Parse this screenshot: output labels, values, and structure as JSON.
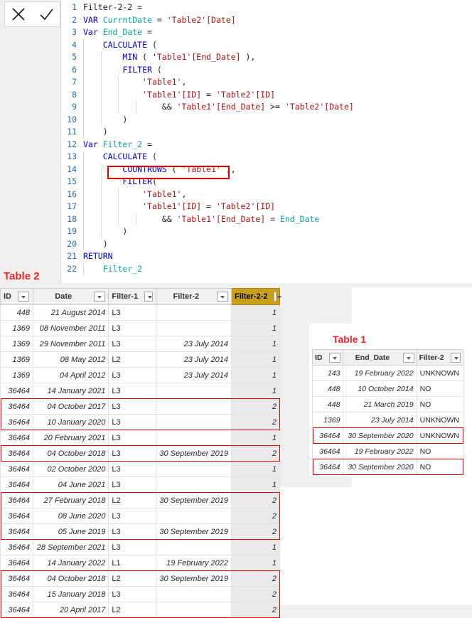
{
  "editor": {
    "commit_icons": [
      {
        "name": "cancel-icon",
        "glyph": "✕"
      },
      {
        "name": "confirm-icon",
        "glyph": "✓"
      }
    ],
    "lines": [
      {
        "n": "1",
        "indent": 0,
        "tokens": [
          {
            "t": "Filter-2-2 =",
            "c": "pl"
          }
        ]
      },
      {
        "n": "2",
        "indent": 0,
        "tokens": [
          {
            "t": "VAR ",
            "c": "kw"
          },
          {
            "t": "CurrntDate",
            "c": "var"
          },
          {
            "t": " = ",
            "c": "op"
          },
          {
            "t": "'Table2'[Date]",
            "c": "str"
          }
        ]
      },
      {
        "n": "3",
        "indent": 0,
        "tokens": [
          {
            "t": "Var ",
            "c": "kw"
          },
          {
            "t": "End_Date",
            "c": "var"
          },
          {
            "t": " =",
            "c": "op"
          }
        ]
      },
      {
        "n": "4",
        "indent": 1,
        "tokens": [
          {
            "t": "CALCULATE",
            "c": "fn"
          },
          {
            "t": " (",
            "c": "op"
          }
        ]
      },
      {
        "n": "5",
        "indent": 2,
        "tokens": [
          {
            "t": "MIN",
            "c": "fn"
          },
          {
            "t": " ( ",
            "c": "op"
          },
          {
            "t": "'Table1'[End_Date]",
            "c": "str"
          },
          {
            "t": " ),",
            "c": "op"
          }
        ]
      },
      {
        "n": "6",
        "indent": 2,
        "tokens": [
          {
            "t": "FILTER",
            "c": "fn"
          },
          {
            "t": " (",
            "c": "op"
          }
        ]
      },
      {
        "n": "7",
        "indent": 3,
        "tokens": [
          {
            "t": "'Table1'",
            "c": "str"
          },
          {
            "t": ",",
            "c": "op"
          }
        ]
      },
      {
        "n": "8",
        "indent": 3,
        "tokens": [
          {
            "t": "'Table1'[ID]",
            "c": "str"
          },
          {
            "t": " = ",
            "c": "op"
          },
          {
            "t": "'Table2'[ID]",
            "c": "str"
          }
        ]
      },
      {
        "n": "9",
        "indent": 4,
        "tokens": [
          {
            "t": "&& ",
            "c": "op"
          },
          {
            "t": "'Table1'[End_Date]",
            "c": "str"
          },
          {
            "t": " >= ",
            "c": "op"
          },
          {
            "t": "'Table2'[Date]",
            "c": "str"
          }
        ]
      },
      {
        "n": "10",
        "indent": 2,
        "tokens": [
          {
            "t": ")",
            "c": "op"
          }
        ]
      },
      {
        "n": "11",
        "indent": 1,
        "tokens": [
          {
            "t": ")",
            "c": "op"
          }
        ]
      },
      {
        "n": "12",
        "indent": 0,
        "tokens": [
          {
            "t": "Var ",
            "c": "kw"
          },
          {
            "t": "Filter_2",
            "c": "var"
          },
          {
            "t": " =",
            "c": "op"
          }
        ]
      },
      {
        "n": "13",
        "indent": 1,
        "tokens": [
          {
            "t": "CALCULATE",
            "c": "fn"
          },
          {
            "t": " (",
            "c": "op"
          }
        ]
      },
      {
        "n": "14",
        "indent": 2,
        "tokens": [
          {
            "t": "COUNTROWS",
            "c": "fn"
          },
          {
            "t": " ( ",
            "c": "op"
          },
          {
            "t": "'Table1'",
            "c": "str"
          },
          {
            "t": " ),",
            "c": "op"
          }
        ]
      },
      {
        "n": "15",
        "indent": 2,
        "tokens": [
          {
            "t": "FILTER",
            "c": "fn"
          },
          {
            "t": "(",
            "c": "op"
          }
        ]
      },
      {
        "n": "16",
        "indent": 3,
        "tokens": [
          {
            "t": "'Table1'",
            "c": "str"
          },
          {
            "t": ",",
            "c": "op"
          }
        ]
      },
      {
        "n": "17",
        "indent": 3,
        "tokens": [
          {
            "t": "'Table1'[ID]",
            "c": "str"
          },
          {
            "t": " = ",
            "c": "op"
          },
          {
            "t": "'Table2'[ID]",
            "c": "str"
          }
        ]
      },
      {
        "n": "18",
        "indent": 4,
        "tokens": [
          {
            "t": "&& ",
            "c": "op"
          },
          {
            "t": "'Table1'[End_Date]",
            "c": "str"
          },
          {
            "t": " = ",
            "c": "op"
          },
          {
            "t": "End_Date",
            "c": "var"
          }
        ]
      },
      {
        "n": "19",
        "indent": 2,
        "tokens": [
          {
            "t": ")",
            "c": "op"
          }
        ]
      },
      {
        "n": "20",
        "indent": 1,
        "tokens": [
          {
            "t": ")",
            "c": "op"
          }
        ]
      },
      {
        "n": "21",
        "indent": 0,
        "tokens": [
          {
            "t": "RETURN",
            "c": "kw"
          }
        ]
      },
      {
        "n": "22",
        "indent": 1,
        "tokens": [
          {
            "t": "Filter_2",
            "c": "var"
          }
        ]
      }
    ],
    "highlight_note": "COUNTROWS ( 'Table1' ),"
  },
  "table2": {
    "label": "Table 2",
    "accent_color": "#c8a01e",
    "highlight_color": "#e00000",
    "columns": [
      "ID",
      "Date",
      "Filter-1",
      "Filter-2",
      "Filter-2-2"
    ],
    "rows": [
      {
        "id": "448",
        "date": "21 August 2014",
        "f1": "L3",
        "f2": "",
        "f22": "1",
        "boxed": false
      },
      {
        "id": "1369",
        "date": "08 November 2011",
        "f1": "L3",
        "f2": "",
        "f22": "1",
        "boxed": false
      },
      {
        "id": "1369",
        "date": "29 November 2011",
        "f1": "L3",
        "f2": "23 July 2014",
        "f22": "1",
        "boxed": false
      },
      {
        "id": "1369",
        "date": "08 May 2012",
        "f1": "L2",
        "f2": "23 July 2014",
        "f22": "1",
        "boxed": false
      },
      {
        "id": "1369",
        "date": "04 April 2012",
        "f1": "L3",
        "f2": "23 July 2014",
        "f22": "1",
        "boxed": false
      },
      {
        "id": "36464",
        "date": "14 January 2021",
        "f1": "L3",
        "f2": "",
        "f22": "1",
        "boxed": false
      },
      {
        "id": "36464",
        "date": "04 October 2017",
        "f1": "L3",
        "f2": "",
        "f22": "2",
        "boxed": true
      },
      {
        "id": "36464",
        "date": "10 January 2020",
        "f1": "L3",
        "f2": "",
        "f22": "2",
        "boxed": true
      },
      {
        "id": "36464",
        "date": "20 February 2021",
        "f1": "L3",
        "f2": "",
        "f22": "1",
        "boxed": false
      },
      {
        "id": "36464",
        "date": "04 October 2018",
        "f1": "L3",
        "f2": "30 September 2019",
        "f22": "2",
        "boxed": true
      },
      {
        "id": "36464",
        "date": "02 October 2020",
        "f1": "L3",
        "f2": "",
        "f22": "1",
        "boxed": false
      },
      {
        "id": "36464",
        "date": "04 June 2021",
        "f1": "L3",
        "f2": "",
        "f22": "1",
        "boxed": false
      },
      {
        "id": "36464",
        "date": "27 February 2018",
        "f1": "L2",
        "f2": "30 September 2019",
        "f22": "2",
        "boxed": true
      },
      {
        "id": "36464",
        "date": "08 June 2020",
        "f1": "L3",
        "f2": "",
        "f22": "2",
        "boxed": true
      },
      {
        "id": "36464",
        "date": "05 June 2019",
        "f1": "L3",
        "f2": "30 September 2019",
        "f22": "2",
        "boxed": true
      },
      {
        "id": "36464",
        "date": "28 September 2021",
        "f1": "L3",
        "f2": "",
        "f22": "1",
        "boxed": false
      },
      {
        "id": "36464",
        "date": "14 January 2022",
        "f1": "L1",
        "f2": "19 February 2022",
        "f22": "1",
        "boxed": false
      },
      {
        "id": "36464",
        "date": "04 October 2018",
        "f1": "L2",
        "f2": "30 September 2019",
        "f22": "2",
        "boxed": true
      },
      {
        "id": "36464",
        "date": "15 January 2018",
        "f1": "L3",
        "f2": "",
        "f22": "2",
        "boxed": true
      },
      {
        "id": "36464",
        "date": "20 April 2017",
        "f1": "L2",
        "f2": "",
        "f22": "2",
        "boxed": true
      }
    ]
  },
  "table1": {
    "label": "Table 1",
    "columns": [
      "ID",
      "End_Date",
      "Filter-2"
    ],
    "rows": [
      {
        "id": "143",
        "end_date": "19 February 2022",
        "f2": "UNKNOWN",
        "boxed": false
      },
      {
        "id": "448",
        "end_date": "10 October 2014",
        "f2": "NO",
        "boxed": false
      },
      {
        "id": "448",
        "end_date": "21 March 2019",
        "f2": "NO",
        "boxed": false
      },
      {
        "id": "1369",
        "end_date": "23 July 2014",
        "f2": "UNKNOWN",
        "boxed": false
      },
      {
        "id": "36464",
        "end_date": "30 September 2020",
        "f2": "UNKNOWN",
        "boxed": true
      },
      {
        "id": "36464",
        "end_date": "19 February 2022",
        "f2": "NO",
        "boxed": false
      },
      {
        "id": "36464",
        "end_date": "30 September 2020",
        "f2": "NO",
        "boxed": true
      }
    ]
  }
}
